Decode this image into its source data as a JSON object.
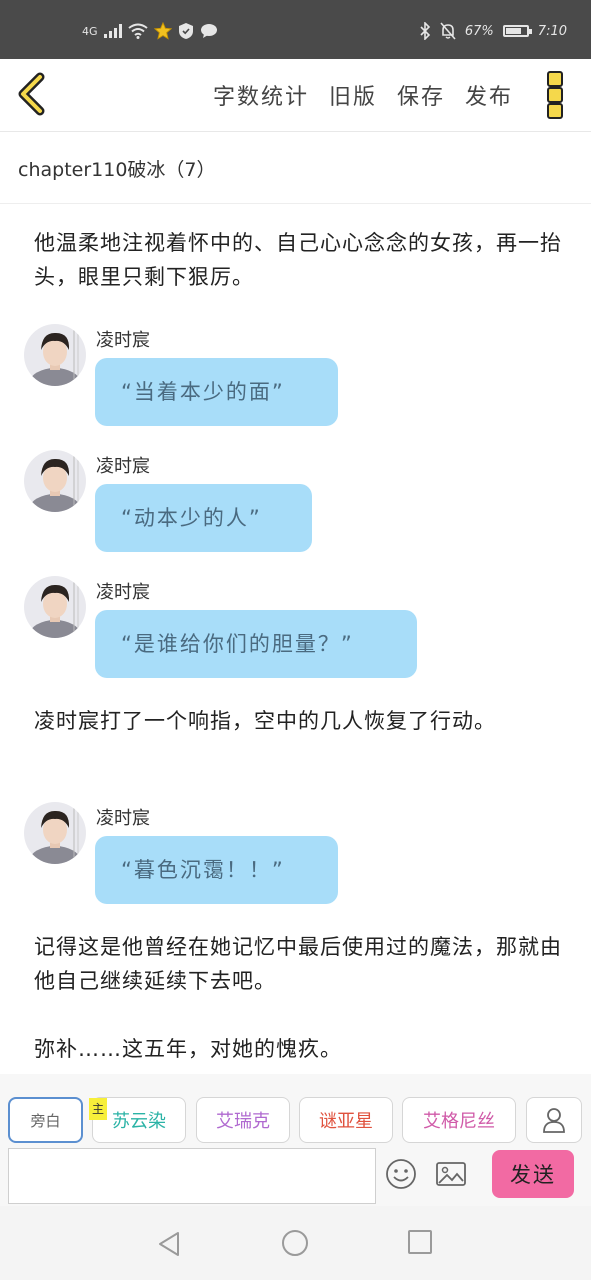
{
  "status_bar": {
    "network": "4G",
    "battery": "67%",
    "battery_level": 0.67,
    "time": "7:10"
  },
  "header": {
    "actions": [
      "字数统计",
      "旧版",
      "保存",
      "发布"
    ]
  },
  "chapter_title": "chapter110破冰（7）",
  "content": {
    "narration_1": "他温柔地注视着怀中的、自己心心念念的女孩，再一抬头，眼里只剩下狠厉。",
    "messages": [
      {
        "speaker": "凌时宸",
        "text": "“当着本少的面”"
      },
      {
        "speaker": "凌时宸",
        "text": "“动本少的人”"
      },
      {
        "speaker": "凌时宸",
        "text": "“是谁给你们的胆量？”"
      }
    ],
    "narration_2": "凌时宸打了一个响指，空中的几人恢复了行动。",
    "message_4": {
      "speaker": "凌时宸",
      "text": "“暮色沉霭！！”"
    },
    "narration_3": "记得这是他曾经在她记忆中最后使用过的魔法，那就由他自己继续延续下去吧。",
    "narration_4": "弥补……这五年，对她的愧疚。"
  },
  "characters": {
    "aside": "旁白",
    "main_tag": "主",
    "list": [
      {
        "name": "苏云染",
        "color": "#2bb3a6"
      },
      {
        "name": "艾瑞克",
        "color": "#b06ad0"
      },
      {
        "name": "谜亚星",
        "color": "#e0523e"
      },
      {
        "name": "艾格尼丝",
        "color": "#d05aa8"
      }
    ]
  },
  "input": {
    "value": "",
    "send_label": "发送"
  },
  "colors": {
    "bubble": "#a8ddf9",
    "send": "#f26aa3",
    "accent_yellow": "#f5d84b"
  }
}
